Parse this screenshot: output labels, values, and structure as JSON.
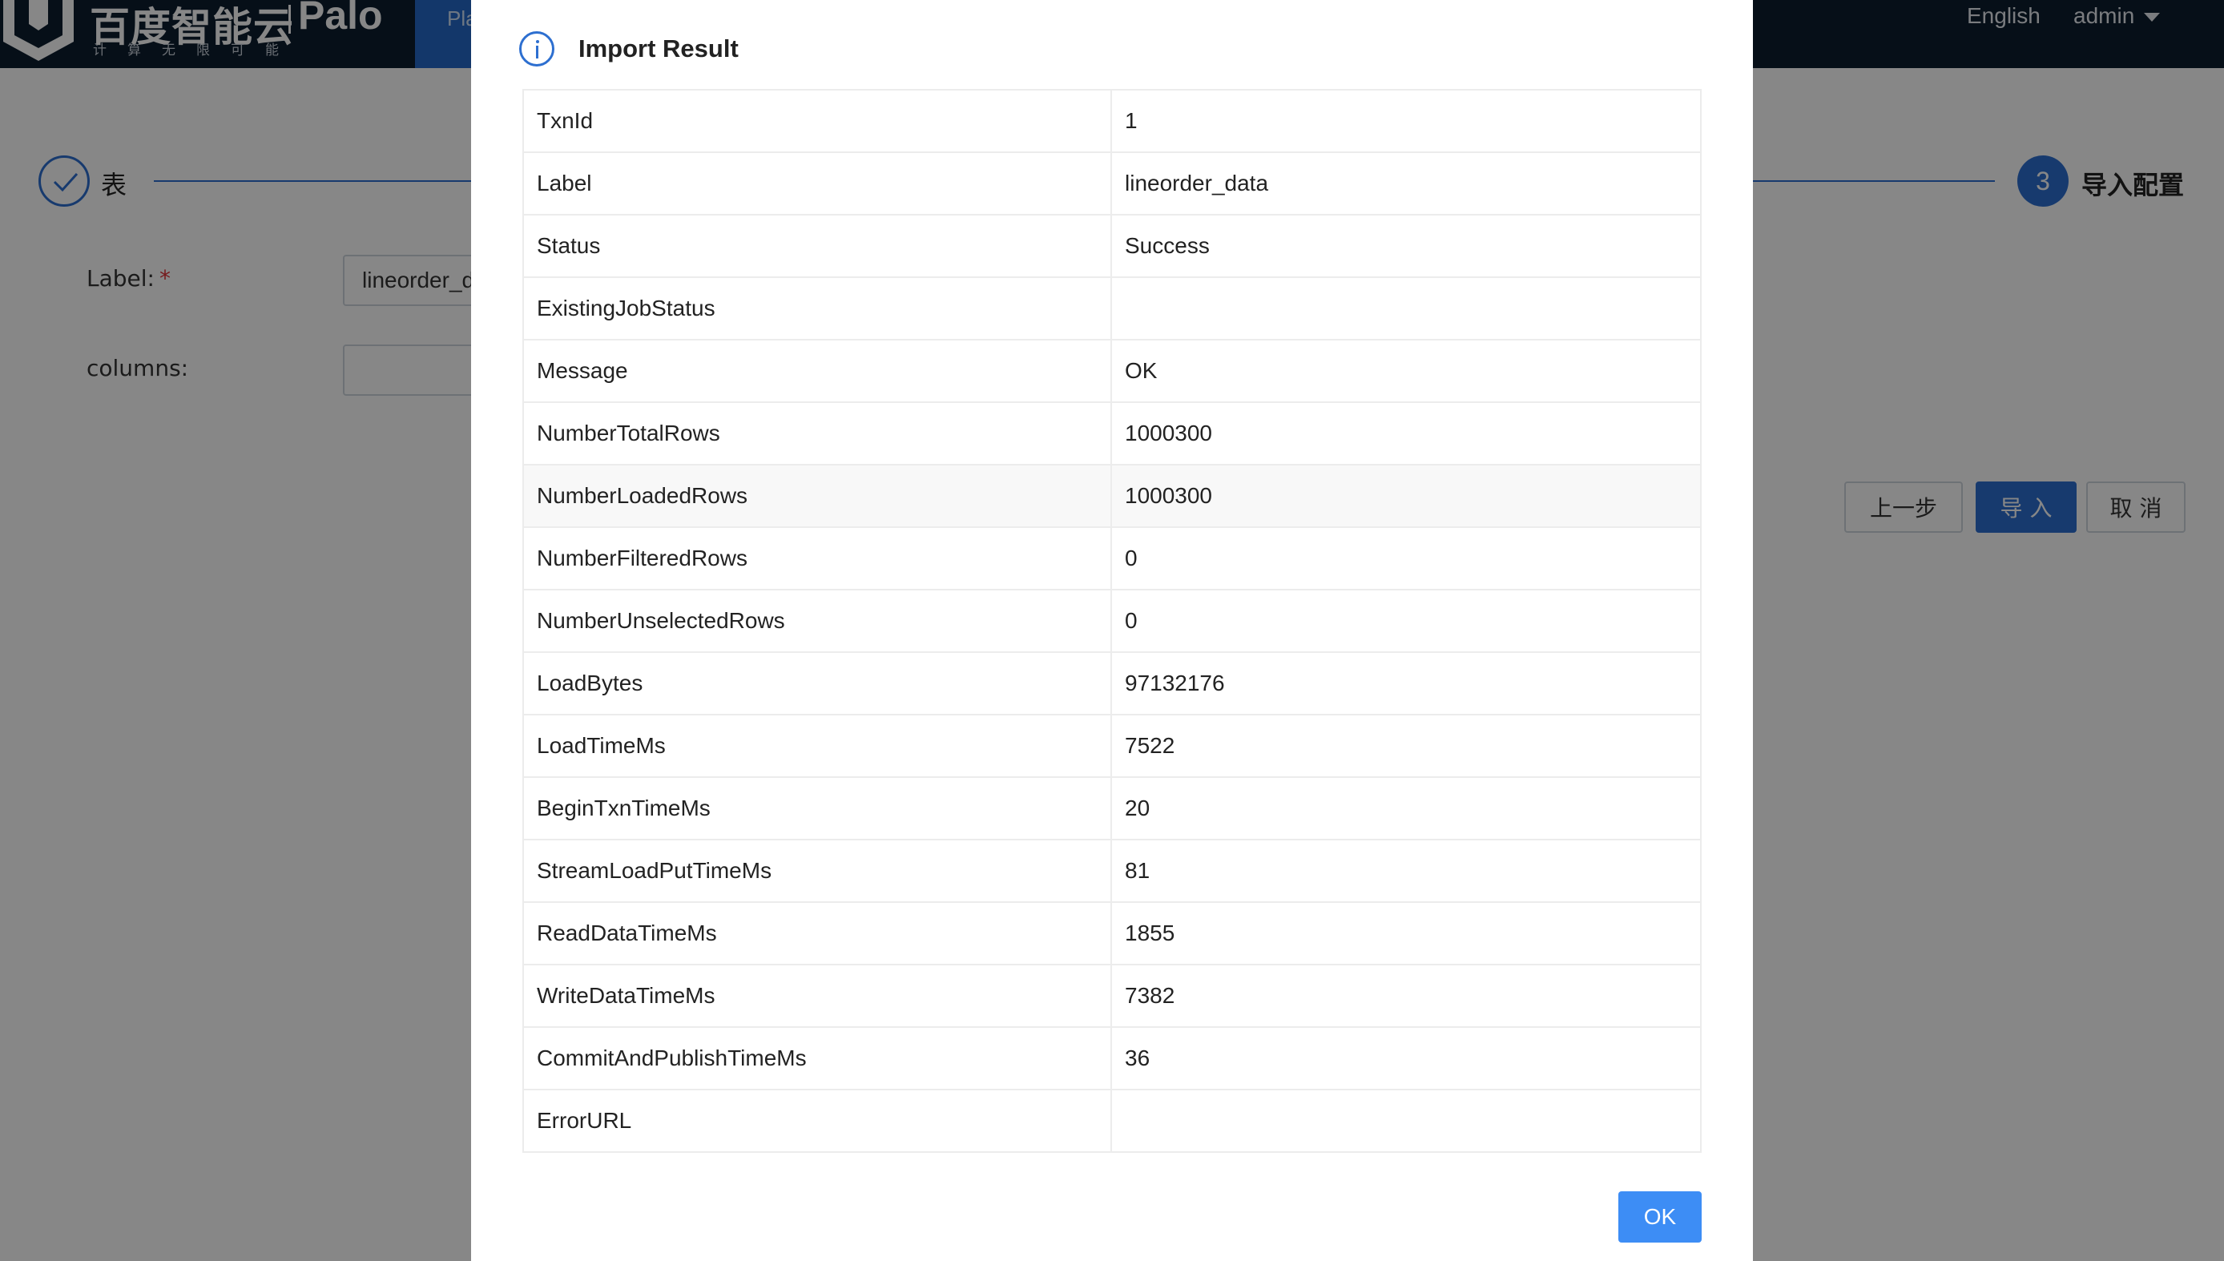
{
  "header": {
    "logo_cn": "百度智能云",
    "logo_product": "Palo",
    "logo_slogan": "计算无限可能",
    "nav_active_label": "Playground",
    "language": "English",
    "user": "admin"
  },
  "steps": {
    "step1_label": "表",
    "step3_number": "3",
    "step3_label": "导入配置"
  },
  "form": {
    "label_field": "Label:",
    "label_required_mark": "*",
    "label_value": "lineorder_data",
    "columns_field": "columns:",
    "columns_value": ""
  },
  "actions": {
    "prev": "上一步",
    "import": "导 入",
    "cancel": "取 消"
  },
  "modal": {
    "title": "Import Result",
    "ok_label": "OK",
    "rows": [
      {
        "key": "TxnId",
        "value": "1"
      },
      {
        "key": "Label",
        "value": "lineorder_data"
      },
      {
        "key": "Status",
        "value": "Success"
      },
      {
        "key": "ExistingJobStatus",
        "value": ""
      },
      {
        "key": "Message",
        "value": "OK"
      },
      {
        "key": "NumberTotalRows",
        "value": "1000300"
      },
      {
        "key": "NumberLoadedRows",
        "value": "1000300"
      },
      {
        "key": "NumberFilteredRows",
        "value": "0"
      },
      {
        "key": "NumberUnselectedRows",
        "value": "0"
      },
      {
        "key": "LoadBytes",
        "value": "97132176"
      },
      {
        "key": "LoadTimeMs",
        "value": "7522"
      },
      {
        "key": "BeginTxnTimeMs",
        "value": "20"
      },
      {
        "key": "StreamLoadPutTimeMs",
        "value": "81"
      },
      {
        "key": "ReadDataTimeMs",
        "value": "1855"
      },
      {
        "key": "WriteDataTimeMs",
        "value": "7382"
      },
      {
        "key": "CommitAndPublishTimeMs",
        "value": "36"
      },
      {
        "key": "ErrorURL",
        "value": ""
      }
    ]
  }
}
